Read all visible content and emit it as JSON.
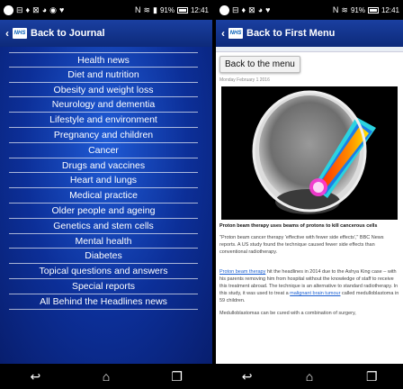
{
  "left": {
    "status": {
      "battery": "91%",
      "time": "12:41"
    },
    "appbar": {
      "title": "Back to Journal"
    },
    "menu": [
      "Health news",
      "Diet and nutrition",
      "Obesity and weight loss",
      "Neurology and dementia",
      "Lifestyle and environment",
      "Pregnancy and children",
      "Cancer",
      "Drugs and vaccines",
      "Heart and lungs",
      "Medical practice",
      "Older people and ageing",
      "Genetics and stem cells",
      "Mental health",
      "Diabetes",
      "Topical questions and answers",
      "Special reports",
      "All Behind the Headlines news"
    ]
  },
  "right": {
    "status": {
      "battery": "91%",
      "time": "12:41"
    },
    "appbar": {
      "title": "Back to First Menu"
    },
    "back_button": "Back to the menu",
    "date": "Monday February 1 2016",
    "caption": "Proton beam therapy uses beams of protons to kill cancerous cells",
    "para1": "\"Proton beam cancer therapy 'effective with fewer side effects',\" BBC News reports. A US study found the technique caused fewer side effects than conventional radiotherapy.",
    "para2_link": "Proton beam therapy",
    "para2": " hit the headlines in 2014 due to the Ashya King case – with his parents removing him from hospital without the knowledge of staff to receive this treatment abroad. The technique is an alternative to standard radiotherapy. In this study, it was used to treat a ",
    "para2_link2": "malignant brain tumour",
    "para2_end": " called medulloblastoma in 59 children.",
    "para3": "Medulloblastomas can be cured with a combination of surgery,"
  },
  "nav_icons": [
    "back-icon",
    "home-icon",
    "recents-icon"
  ]
}
